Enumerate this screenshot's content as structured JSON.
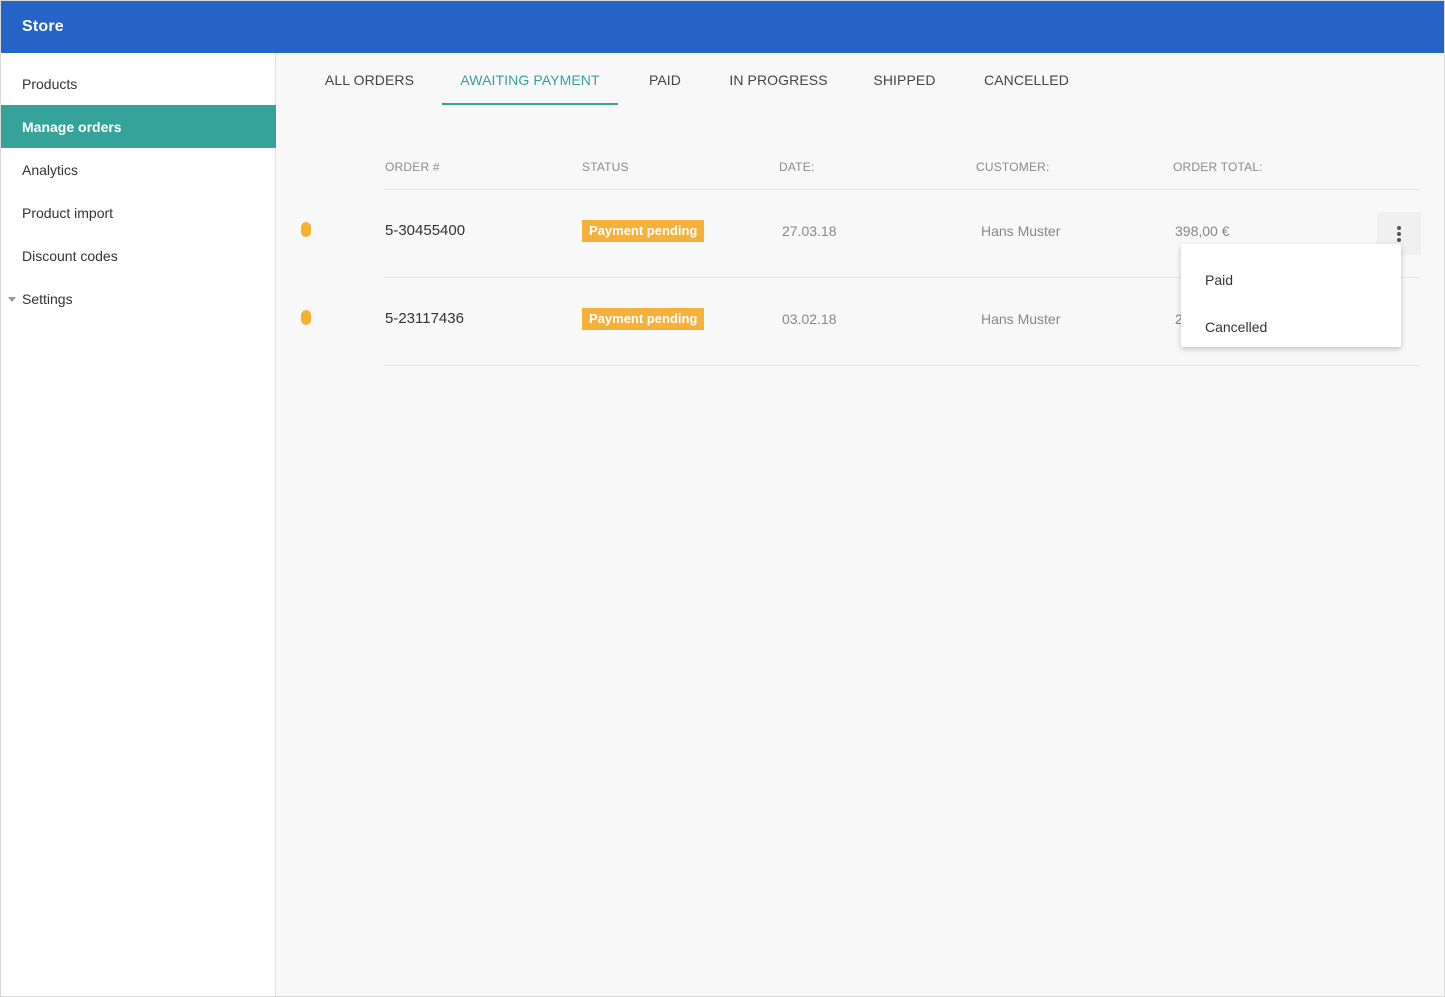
{
  "app": {
    "title": "Store"
  },
  "sidebar": {
    "items": [
      {
        "label": "Products"
      },
      {
        "label": "Manage orders"
      },
      {
        "label": "Analytics"
      },
      {
        "label": "Product import"
      },
      {
        "label": "Discount codes"
      },
      {
        "label": "Settings"
      }
    ],
    "active_index": 1
  },
  "tabs": [
    {
      "label": "ALL ORDERS"
    },
    {
      "label": "AWAITING PAYMENT"
    },
    {
      "label": "PAID"
    },
    {
      "label": "IN PROGRESS"
    },
    {
      "label": "SHIPPED"
    },
    {
      "label": "CANCELLED"
    }
  ],
  "active_tab": 1,
  "table": {
    "headers": [
      "ORDER #",
      "STATUS",
      "DATE:",
      "CUSTOMER:",
      "ORDER TOTAL:"
    ],
    "rows": [
      {
        "order": "5-30455400",
        "status": "Payment pending",
        "date": "27.03.18",
        "customer": "Hans Muster",
        "total": "398,00 €"
      },
      {
        "order": "5-23117436",
        "status": "Payment pending",
        "date": "03.02.18",
        "customer": "Hans Muster",
        "total": "2"
      }
    ]
  },
  "menu": {
    "items": [
      {
        "label": "Paid"
      },
      {
        "label": "Cancelled"
      }
    ]
  },
  "colors": {
    "appbar": "#2563c7",
    "accent": "#36a39a",
    "pending": "#f6b13a"
  }
}
